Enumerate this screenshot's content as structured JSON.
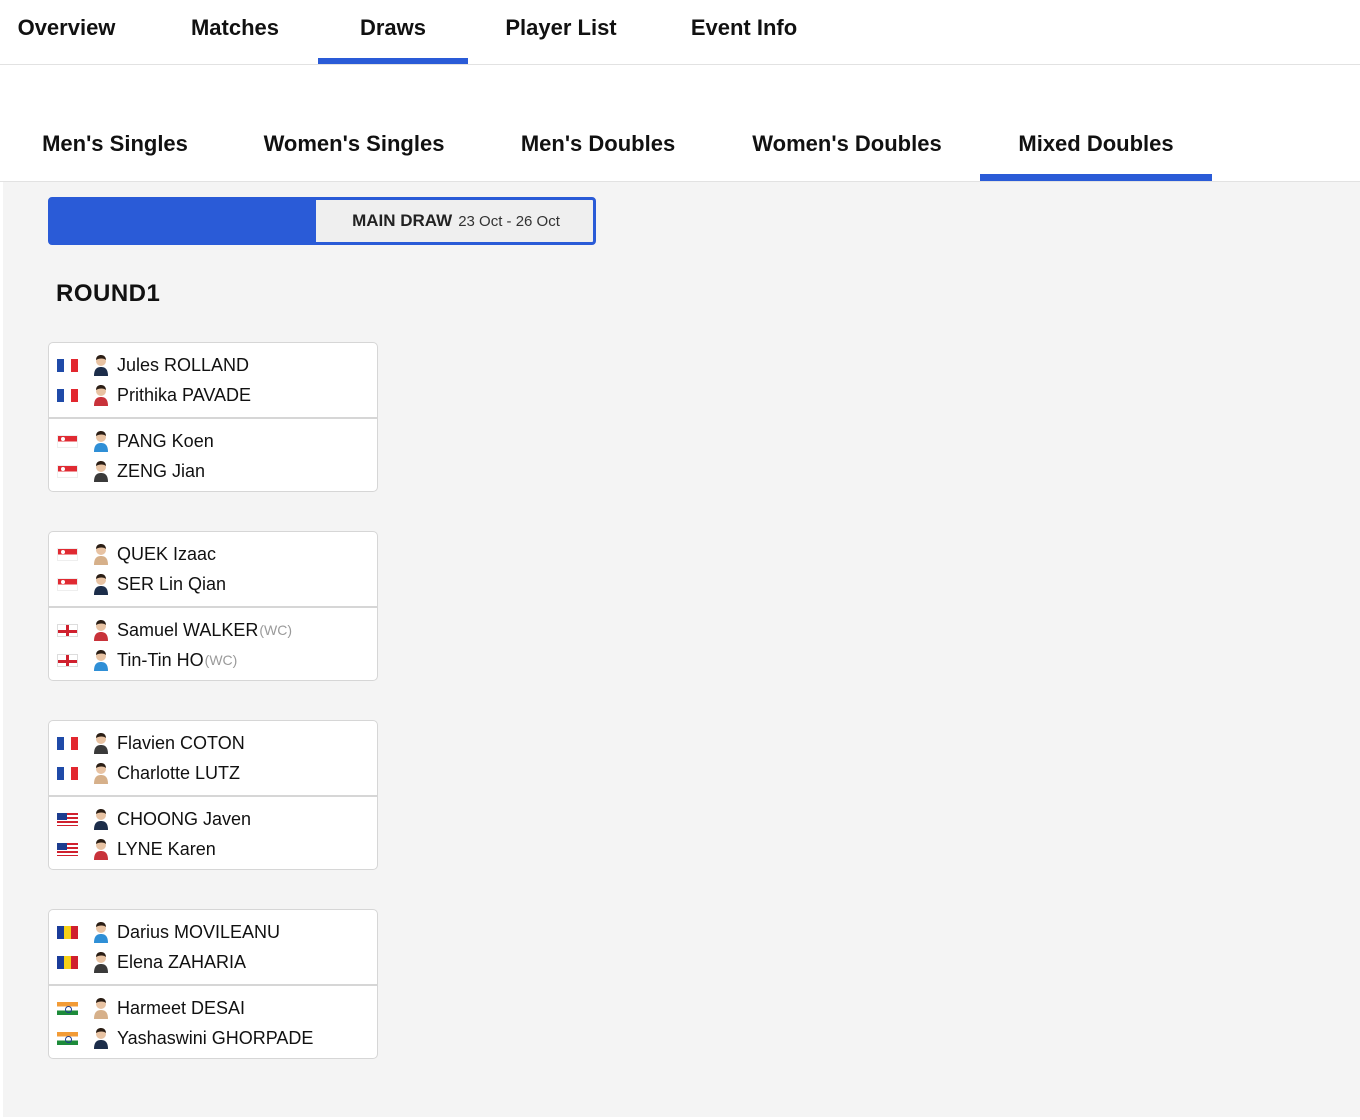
{
  "top_tabs": [
    {
      "label": "Overview",
      "active": false
    },
    {
      "label": "Matches",
      "active": false
    },
    {
      "label": "Draws",
      "active": true
    },
    {
      "label": "Player List",
      "active": false
    },
    {
      "label": "Event Info",
      "active": false
    }
  ],
  "event_tabs": [
    {
      "label": "Men's Singles",
      "active": false
    },
    {
      "label": "Women's Singles",
      "active": false
    },
    {
      "label": "Men's Doubles",
      "active": false
    },
    {
      "label": "Women's Doubles",
      "active": false
    },
    {
      "label": "Mixed Doubles",
      "active": true
    }
  ],
  "draw_toggle": {
    "main_label": "MAIN DRAW",
    "main_dates": "23 Oct - 26 Oct",
    "accent_color": "#2a5bd7"
  },
  "round": {
    "title": "ROUND1"
  },
  "matches": [
    {
      "teams": [
        {
          "flag": "fra",
          "players": [
            {
              "name": "Jules ROLLAND",
              "tag": ""
            },
            {
              "name": "Prithika PAVADE",
              "tag": ""
            }
          ]
        },
        {
          "flag": "sgp",
          "players": [
            {
              "name": "PANG Koen",
              "tag": ""
            },
            {
              "name": "ZENG Jian",
              "tag": ""
            }
          ]
        }
      ]
    },
    {
      "teams": [
        {
          "flag": "sgp",
          "players": [
            {
              "name": "QUEK Izaac",
              "tag": ""
            },
            {
              "name": "SER Lin Qian",
              "tag": ""
            }
          ]
        },
        {
          "flag": "eng",
          "players": [
            {
              "name": "Samuel WALKER",
              "tag": "(WC)"
            },
            {
              "name": "Tin-Tin HO",
              "tag": "(WC)"
            }
          ]
        }
      ]
    },
    {
      "teams": [
        {
          "flag": "fra",
          "players": [
            {
              "name": "Flavien COTON",
              "tag": ""
            },
            {
              "name": "Charlotte LUTZ",
              "tag": ""
            }
          ]
        },
        {
          "flag": "mas",
          "players": [
            {
              "name": "CHOONG Javen",
              "tag": ""
            },
            {
              "name": "LYNE Karen",
              "tag": ""
            }
          ]
        }
      ]
    },
    {
      "teams": [
        {
          "flag": "rou",
          "players": [
            {
              "name": "Darius MOVILEANU",
              "tag": ""
            },
            {
              "name": "Elena ZAHARIA",
              "tag": ""
            }
          ]
        },
        {
          "flag": "ind",
          "players": [
            {
              "name": "Harmeet DESAI",
              "tag": ""
            },
            {
              "name": "Yashaswini GHORPADE",
              "tag": ""
            }
          ]
        }
      ]
    }
  ]
}
